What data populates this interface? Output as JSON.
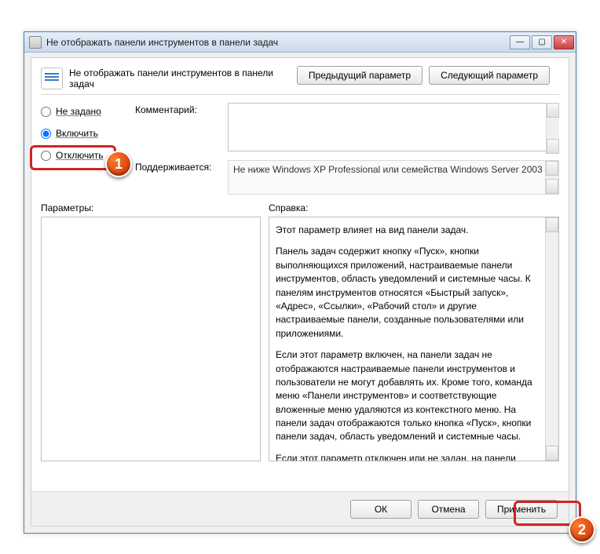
{
  "window": {
    "title": "Не отображать панели инструментов в панели задач"
  },
  "header": {
    "policy_title": "Не отображать панели инструментов в панели задач"
  },
  "nav": {
    "prev": "Предыдущий параметр",
    "next": "Следующий параметр"
  },
  "radios": {
    "not_configured": "Не задано",
    "enabled": "Включить",
    "disabled": "Отключить",
    "selected": "enabled"
  },
  "fields": {
    "comment_label": "Комментарий:",
    "comment_value": "",
    "supported_label": "Поддерживается:",
    "supported_value": "Не ниже Windows XP Professional или семейства Windows Server 2003"
  },
  "panels": {
    "options_label": "Параметры:",
    "help_label": "Справка:"
  },
  "help": {
    "p1": "Этот параметр влияет на вид панели задач.",
    "p2": "Панель задач содержит кнопку «Пуск», кнопки выполняющихся приложений, настраиваемые панели инструментов, область уведомлений и системные часы. К панелям инструментов относятся «Быстрый запуск», «Адрес», «Ссылки», «Рабочий стол» и другие настраиваемые панели, созданные пользователями или приложениями.",
    "p3": "Если этот параметр включен, на панели задач не отображаются настраиваемые панели инструментов и пользователи не могут добавлять их. Кроме того, команда меню «Панели инструментов» и соответствующие вложенные меню удаляются из контекстного меню. На панели задач отображаются только кнопка «Пуск», кнопки панели задач, область уведомлений и системные часы.",
    "p4": "Если этот параметр отключен или не задан, на панели задач отображаются все панели инструментов. Пользователи могут добавлять или удалять настраиваемые панели"
  },
  "footer": {
    "ok": "ОК",
    "cancel": "Отмена",
    "apply": "Применить"
  },
  "markers": {
    "m1": "1",
    "m2": "2"
  }
}
